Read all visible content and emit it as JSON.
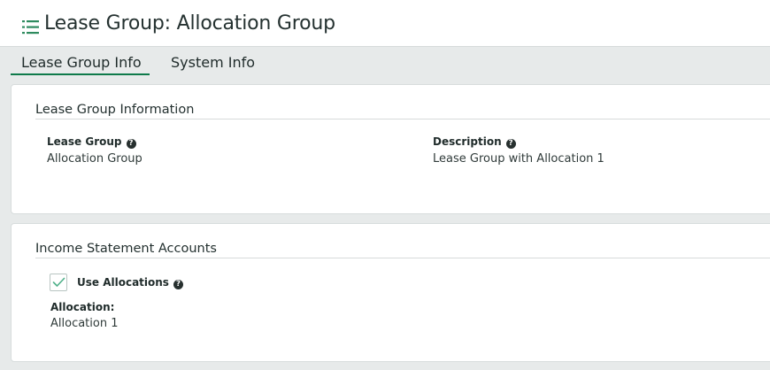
{
  "header": {
    "icon": "list-icon",
    "title": "Lease Group: Allocation Group"
  },
  "tabs": [
    {
      "label": "Lease Group Info",
      "active": true
    },
    {
      "label": "System Info",
      "active": false
    }
  ],
  "lease_group_section": {
    "title": "Lease Group Information",
    "fields": {
      "lease_group": {
        "label": "Lease Group",
        "value": "Allocation Group"
      },
      "description": {
        "label": "Description",
        "value": "Lease Group with Allocation 1"
      }
    }
  },
  "income_section": {
    "title": "Income Statement Accounts",
    "use_allocations": {
      "label": "Use Allocations",
      "checked": true
    },
    "allocation": {
      "label": "Allocation:",
      "value": "Allocation 1"
    }
  },
  "help_glyph": "?",
  "colors": {
    "accent": "#0e7a4a",
    "icon_green": "#2e8b5f",
    "checkmark": "#4fb08a",
    "background": "#e7eaea"
  }
}
